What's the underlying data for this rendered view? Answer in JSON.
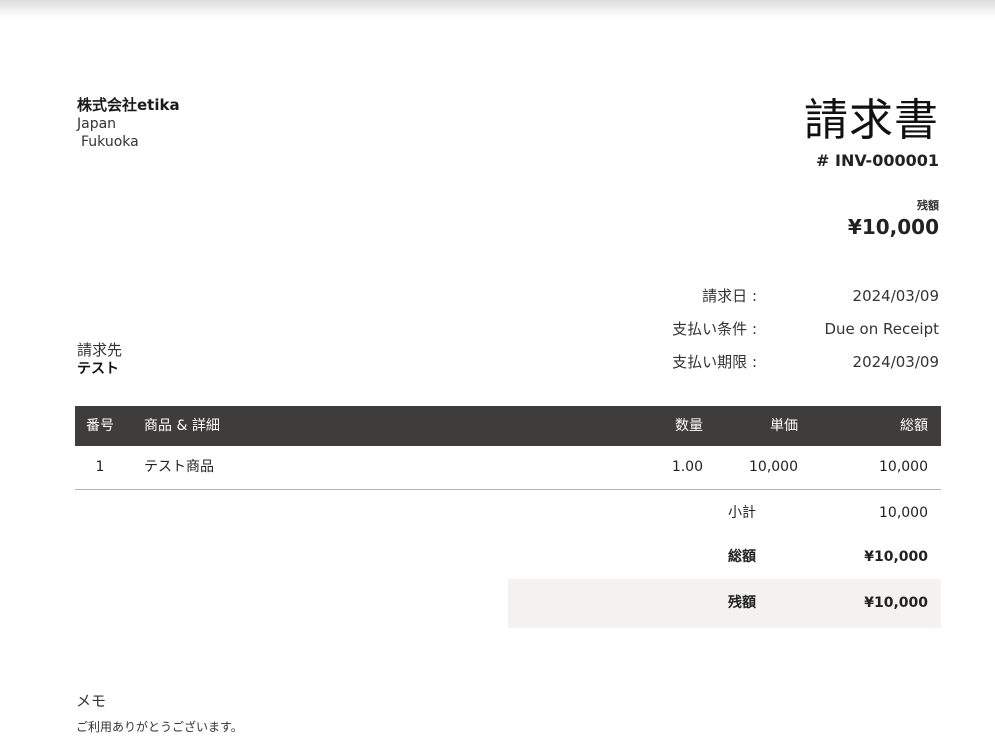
{
  "company": {
    "name": "株式会社etika",
    "country": "Japan",
    "city": "Fukuoka"
  },
  "document": {
    "title": "請求書",
    "number": "# INV-000001",
    "balance_label": "残額",
    "balance_amount": "¥10,000"
  },
  "meta": {
    "invoice_date_label": "請求日 :",
    "invoice_date": "2024/03/09",
    "terms_label": "支払い条件 :",
    "terms": "Due on Receipt",
    "due_date_label": "支払い期限 :",
    "due_date": "2024/03/09"
  },
  "bill_to": {
    "label": "請求先",
    "name": "テスト"
  },
  "items_table": {
    "headers": {
      "no": "番号",
      "description": "商品 & 詳細",
      "qty": "数量",
      "rate": "単価",
      "amount": "総額"
    },
    "rows": [
      {
        "no": "1",
        "description": "テスト商品",
        "qty": "1.00",
        "rate": "10,000",
        "amount": "10,000"
      }
    ]
  },
  "totals": {
    "subtotal_label": "小計",
    "subtotal": "10,000",
    "total_label": "総額",
    "total": "¥10,000",
    "balance_label": "残額",
    "balance": "¥10,000"
  },
  "notes": {
    "label": "メモ",
    "text": "ご利用ありがとうございます。"
  }
}
